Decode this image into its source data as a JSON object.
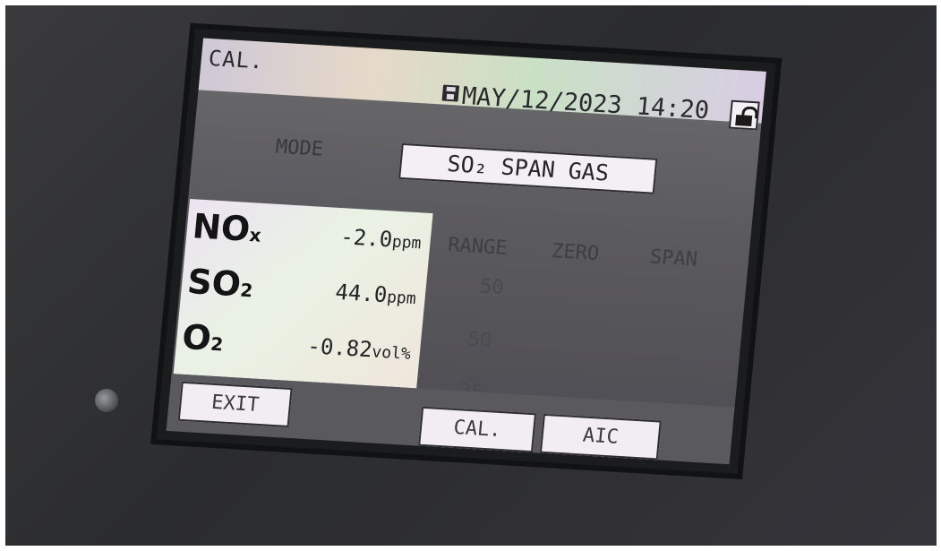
{
  "header": {
    "title": "CAL.",
    "datetime": "MAY/12/2023 14:20"
  },
  "icons": {
    "save": "floppy-disk-icon",
    "lock": "unlocked-padlock-icon"
  },
  "mode": {
    "label": "MODE",
    "value": "SO₂ SPAN GAS"
  },
  "columns": {
    "range": "RANGE",
    "zero": "ZERO",
    "span": "SPAN"
  },
  "gases": [
    {
      "name": "NO",
      "sub": "x",
      "value": "-2.0",
      "unit": "ppm",
      "range": "50"
    },
    {
      "name": "SO",
      "sub": "2",
      "value": "44.0",
      "unit": "ppm",
      "range": "50"
    },
    {
      "name": "O",
      "sub": "2",
      "value": "-0.82",
      "unit": "vol%",
      "range": "25"
    }
  ],
  "buttons": {
    "exit": "EXIT",
    "cal": "CAL.",
    "aic": "AIC"
  }
}
